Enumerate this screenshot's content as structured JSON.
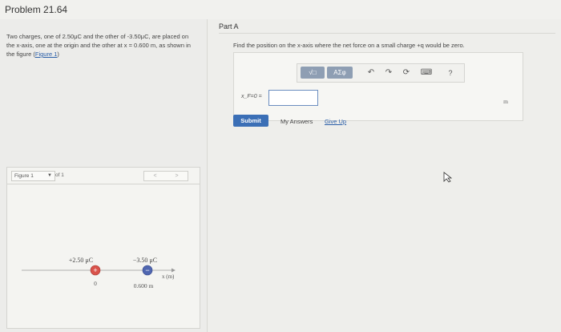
{
  "header": {
    "problem_title": "Problem 21.64"
  },
  "problem": {
    "text_before_link": "Two charges, one of 2.50μC and the other of -3.50μC, are placed on the x-axis, one at the origin and the other at x = 0.600 m, as shown in the figure (",
    "link_text": "Figure 1",
    "text_after_link": ")"
  },
  "figure": {
    "selector_label": "Figure 1",
    "of_label": "of 1",
    "nav_prev": "<",
    "nav_next": ">",
    "charge1_label": "+2.50 μC",
    "charge2_label": "−3.50 μC",
    "charge1_sign": "+",
    "charge2_sign": "−",
    "origin_label": "0",
    "position_label": "0.600 m",
    "axis_label": "x (m)",
    "positive_color": "#d9524a",
    "negative_color": "#4f66b0"
  },
  "part": {
    "title": "Part A",
    "question": "Find the position on the x-axis where the net force on a small charge +q would be zero."
  },
  "answer": {
    "label": "x_F=0 =",
    "value": "",
    "placeholder": "",
    "unit": "m"
  },
  "toolbar": {
    "templates_label": "√□",
    "symbols_label": "ΑΣφ",
    "undo_icon": "↶",
    "redo_icon": "↷",
    "reset_icon": "⟳",
    "keyboard_icon": "⌨",
    "help_label": "?"
  },
  "actions": {
    "submit_label": "Submit",
    "my_answers_label": "My Answers",
    "give_up_label": "Give Up"
  },
  "colors": {
    "accent": "#3b6fb6",
    "toolbar_button": "#8e9eb3",
    "link": "#2a5ea8"
  }
}
